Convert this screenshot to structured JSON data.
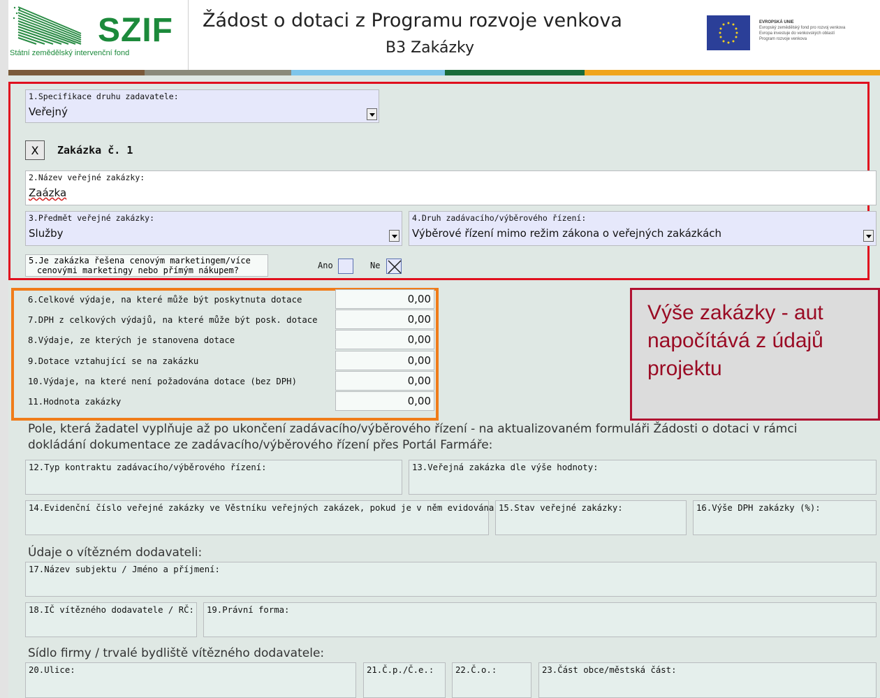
{
  "header": {
    "logo_text": "SZIF",
    "logo_subtitle": "Státní zemědělský intervenční fond",
    "title": "Žádost o dotaci z Programu rozvoje venkova",
    "subtitle": "B3 Zakázky",
    "eu_heading": "EVROPSKÁ UNIE",
    "eu_line1": "Evropský zemědělský fond pro rozvoj venkova",
    "eu_line2": "Evropa investuje do venkovských oblastí",
    "eu_line3": "Program rozvoje venkova"
  },
  "colors": {
    "brown": "#7a5a3a",
    "light_blue": "#7ec5ea",
    "green": "#1a6b3a",
    "orange": "#f0a51c",
    "red_border": "#e0101e",
    "orange_border": "#f07c1a",
    "callout_text": "#9a0b24"
  },
  "form": {
    "q1_label": "1.Specifikace druhu zadavatele:",
    "q1_value": "Veřejný",
    "remove_button": "X",
    "zakazka_title": "Zakázka č. 1",
    "q2_label": "2.Název veřejné zakázky:",
    "q2_value": "Zaázka",
    "q3_label": "3.Předmět veřejné zakázky:",
    "q3_value": "Služby",
    "q4_label": "4.Druh zadávacího/výběrového řízení:",
    "q4_value": "Výběrové řízení mimo režim zákona o veřejných zakázkách",
    "q5_line1": "5.Je zakázka řešena cenovým marketingem/více",
    "q5_line2": "cenovými marketingy nebo přímým nákupem?",
    "ano_label": "Ano",
    "ne_label": "Ne",
    "ne_checked": true
  },
  "costs": [
    {
      "label": "6.Celkové výdaje, na které může být poskytnuta dotace",
      "value": "0,00"
    },
    {
      "label": "7.DPH z celkových výdajů, na které může být posk. dotace",
      "value": "0,00"
    },
    {
      "label": "8.Výdaje, ze kterých je stanovena dotace",
      "value": "0,00"
    },
    {
      "label": "9.Dotace vztahující se na zakázku",
      "value": "0,00"
    },
    {
      "label": "10.Výdaje, na které není požadována dotace (bez DPH)",
      "value": "0,00"
    },
    {
      "label": "11.Hodnota zakázky",
      "value": "0,00"
    }
  ],
  "callout": {
    "line1": "Výše zakázky - aut",
    "line2": "napočítává z údajů",
    "line3": "projektu"
  },
  "post_section": {
    "intro_line1": "Pole, která žadatel vyplňuje až po ukončení zadávacího/výběrového řízení - na aktualizovaném formuláři Žádosti o dotaci v rámci",
    "intro_line2": "dokládání dokumentace ze zadávacího/výběrového řízení přes Portál Farmáře:",
    "f12": "12.Typ kontraktu zadávacího/výběrového řízení:",
    "f13": "13.Veřejná zakázka dle výše hodnoty:",
    "f14": "14.Evidenční číslo veřejné zakázky ve Věstníku veřejných zakázek, pokud je v něm evidována:",
    "f15": "15.Stav veřejné zakázky:",
    "f16": "16.Výše DPH zakázky (%):",
    "winner_heading": "Údaje o vítězném dodavateli:",
    "f17": "17.Název subjektu / Jméno a příjmení:",
    "f18": "18.IČ vítězného dodavatele / RČ:",
    "f19": "19.Právní forma:",
    "address_heading": "Sídlo firmy / trvalé bydliště vítězného dodavatele:",
    "f20": "20.Ulice:",
    "f21": "21.Č.p./Č.e.:",
    "f22": "22.Č.o.:",
    "f23": "23.Část obce/městská část:"
  }
}
